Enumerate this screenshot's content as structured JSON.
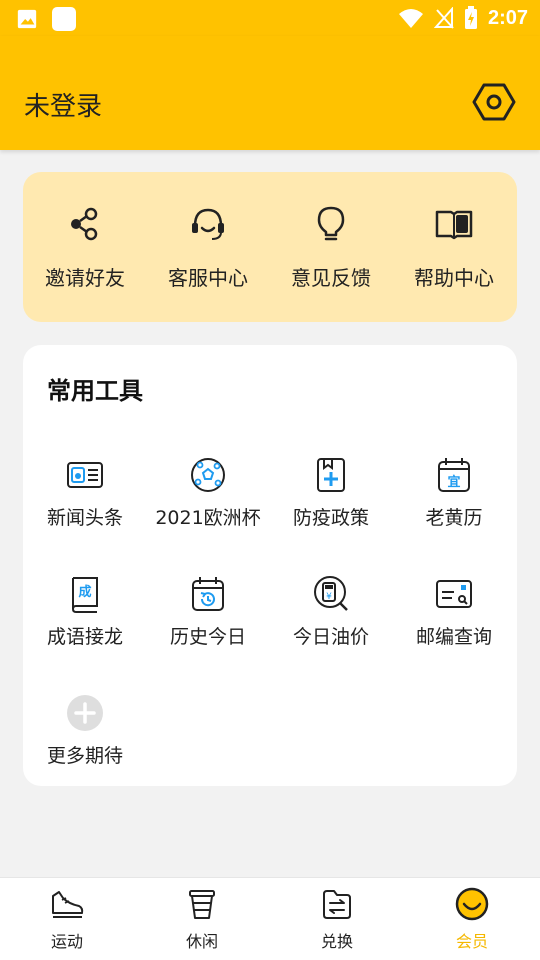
{
  "status_bar": {
    "time": "2:07"
  },
  "header": {
    "title": "未登录"
  },
  "quick_actions": [
    {
      "label": "邀请好友",
      "icon": "share-icon"
    },
    {
      "label": "客服中心",
      "icon": "headset-icon"
    },
    {
      "label": "意见反馈",
      "icon": "lightbulb-icon"
    },
    {
      "label": "帮助中心",
      "icon": "book-icon"
    }
  ],
  "tools": {
    "title": "常用工具",
    "items": [
      {
        "label": "新闻头条",
        "icon": "news-icon"
      },
      {
        "label": "2021欧洲杯",
        "icon": "soccer-ball-icon"
      },
      {
        "label": "防疫政策",
        "icon": "medical-bookmark-icon"
      },
      {
        "label": "老黄历",
        "icon": "calendar-icon",
        "glyph": "宜"
      },
      {
        "label": "成语接龙",
        "icon": "idiom-book-icon",
        "glyph": "成"
      },
      {
        "label": "历史今日",
        "icon": "history-calendar-icon"
      },
      {
        "label": "今日油价",
        "icon": "fuel-icon"
      },
      {
        "label": "邮编查询",
        "icon": "postcode-search-icon"
      },
      {
        "label": "更多期待",
        "icon": "plus-circle-icon"
      }
    ]
  },
  "bottom_nav": [
    {
      "label": "运动",
      "icon": "sneaker-icon",
      "active": false
    },
    {
      "label": "休闲",
      "icon": "coffee-cup-icon",
      "active": false
    },
    {
      "label": "兑换",
      "icon": "exchange-icon",
      "active": false
    },
    {
      "label": "会员",
      "icon": "smiley-icon",
      "active": true
    }
  ],
  "colors": {
    "brand": "#ffc200",
    "quick_bg": "#ffe9b0",
    "accent_blue": "#1e9bf0",
    "active_tab": "#f5b800"
  }
}
